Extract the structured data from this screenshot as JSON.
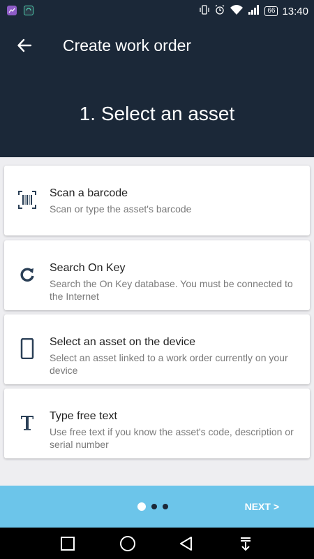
{
  "status_bar": {
    "battery": "66",
    "time": "13:40"
  },
  "header": {
    "title": "Create work order",
    "step_title": "1. Select an asset"
  },
  "options": [
    {
      "title": "Scan a barcode",
      "description": "Scan or type the asset's barcode",
      "icon": "barcode-icon"
    },
    {
      "title": "Search On Key",
      "description": "Search the On Key database. You must be connected to the Internet",
      "icon": "refresh-icon"
    },
    {
      "title": "Select an asset on the device",
      "description": "Select an asset linked to a work order currently on your device",
      "icon": "phone-icon"
    },
    {
      "title": "Type free text",
      "description": "Use free text if you know the asset's code, description or serial number",
      "icon": "text-icon"
    }
  ],
  "footer": {
    "next_label": "NEXT >",
    "page_index": 1,
    "page_count": 3
  },
  "colors": {
    "header_bg": "#1b2838",
    "footer_bg": "#6cc5ea",
    "icon": "#2a3f56"
  }
}
